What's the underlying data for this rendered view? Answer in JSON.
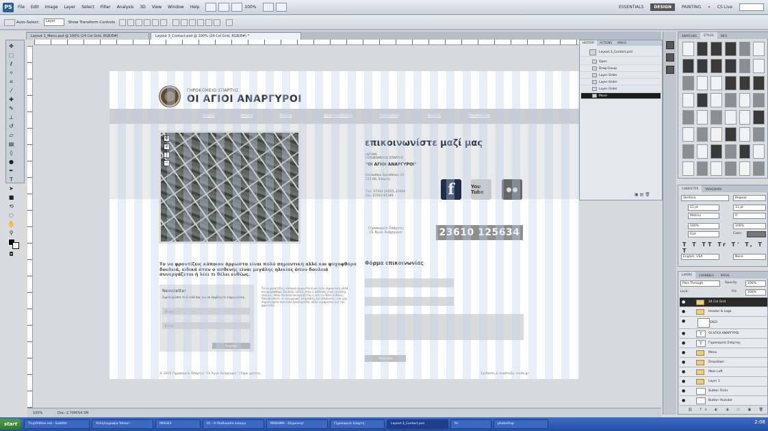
{
  "menubar": {
    "logo": "PS",
    "items": [
      "File",
      "Edit",
      "Image",
      "Layer",
      "Select",
      "Filter",
      "Analysis",
      "3D",
      "View",
      "Window",
      "Help"
    ],
    "zoom": "100%",
    "workspaces": [
      "ESSENTIALS",
      "DESIGN",
      "PAINTING"
    ],
    "more": "»",
    "search": "CS Live"
  },
  "options": {
    "auto_select": "Auto-Select:",
    "auto_select_value": "Layer",
    "show_transform": "Show Transform Controls"
  },
  "doc_tabs": [
    "Layout 1_Menu.psd @ 100% (24 Col Grid, RGB/8#)",
    "Layout 3_Contact.psd @ 100% (24 Col Grid, RGB/8#) *"
  ],
  "site": {
    "subtitle": "ΓΗΡΟΚΟΜΕΙΟ ΣΠΑΡΤΗΣ",
    "title": "ΟΙ ΑΓΙΟΙ ΑΝΑΡΓΥΡΟΙ",
    "nav": [
      "Αρχική",
      "Ιστορία",
      "Ιδρυμα",
      "Δραστηριότητες",
      "Προσωπικό",
      "Δωρεές",
      "Επικοινωνία"
    ],
    "contact_heading": "επικοινωνίστε μαζί μας",
    "org_small": [
      "ΙΔΡΥΜΑ",
      "ΓΕΡΟΚΟΜΕΙΟΝ ΣΠΑΡΤΗΣ"
    ],
    "org_name": "\"ΟΙ ΑΓΙΟΙ ΑΝΑΡΓΥΡΟΙ\"",
    "address": [
      "Επισκόπου Βρεσθένης 20",
      "231 00, Σπάρτη"
    ],
    "phone_fax": [
      "Τηλ. 27310 26555, 23006",
      "Fax. 27310 81340"
    ],
    "social": {
      "facebook": "f",
      "youtube": "You Tube",
      "flickr": "flickr"
    },
    "caption": [
      "Γηροκομείο Σπάρτης",
      "Οι Αγιοι Ανάργυροι"
    ],
    "phone_big": "23610 125634",
    "body_lead": "Το να φροντίζεις κάποιον άρρωστο είναι πολύ σημαντική αλλά και ψυχοφθόρα δουλειά, ειδικά όταν ο ασθενής είναι μεγάλης ηλικίας όπου δουλειά συνεργάζεται ή λέει τι θέλει ευθέως.",
    "newsletter": {
      "title": "Newsletter",
      "text": "Συμπληρώστε το E-mail σας για να λαμβάνετε ενημερώσεις.",
      "name_placeholder": "Όνομα",
      "email_placeholder": "E-mail",
      "submit": "Εγγραφή"
    },
    "info_text": "Το να φροντίζεις κάποιον άρρωστο είναι πολύ σημαντική αλλά και ψυχοφθόρα δουλειά, ειδικά όταν ο ασθενής είναι μεγάλης ηλικίας, όπου δουλειά συνεργάζεται ή λέει τι θέλει ευθέως. Απευθυνθείτε σε κοινωνικές υπηρεσίες και εθελοντές, και μην παραλείψετε ένα καλό ξεκούραστο, άλλο ευχαριστώ για την φροντίδα.",
    "form_title": "Φόρμα επικοινωνίας",
    "form_submit": "Αποστολή",
    "footer_left": "© 2010 Γηροκομείο Σπάρτης \"Οι Άγιοι Ανάργυροι\"  |  Όροι χρήσης",
    "footer_right": "Σχεδίαση & ανάπτυξη: lesite.gr"
  },
  "history": {
    "tabs": [
      "HISTORY",
      "ACTIONS",
      "MINI B"
    ],
    "snapshot": "Layout 3_Contact.psd",
    "items": [
      "Open",
      "Drag Group",
      "Layer Order",
      "Layer Order",
      "Layer Order",
      "Move"
    ]
  },
  "swatches": {
    "tabs": [
      "SWATCHES",
      "STYLES",
      "INFO"
    ]
  },
  "character": {
    "tabs": [
      "CHARACTER",
      "PARAGRAPH"
    ],
    "font": "Verdana",
    "style": "Regular",
    "size": "11 pt",
    "leading": "11 pt",
    "kerning": "Metrics",
    "tracking": "0",
    "vscale": "100%",
    "hscale": "100%",
    "baseline": "0 pt",
    "color_label": "Color:",
    "language": "English: USA",
    "aa": "None"
  },
  "layers": {
    "tabs": [
      "LAYERS",
      "CHANNELS",
      "PATHS"
    ],
    "blend": "Pass Through",
    "opacity_label": "Opacity:",
    "opacity": "100%",
    "fill_label": "Fill:",
    "fill": "100%",
    "lock_label": "Lock:",
    "rows": [
      {
        "name": "24 Col Grid",
        "kind": "folder"
      },
      {
        "name": "Header & Logo",
        "kind": "folder"
      },
      {
        "name": "LOGO",
        "kind": "image"
      },
      {
        "name": "ΟΙ ΑΓΙΟΙ ΑΝΑΡΓΥΡΟΙ",
        "kind": "text"
      },
      {
        "name": "Γηροκομείο Σπάρτης",
        "kind": "text"
      },
      {
        "name": "Menu",
        "kind": "folder"
      },
      {
        "name": "Dropdown",
        "kind": "folder"
      },
      {
        "name": "Main Left",
        "kind": "folder"
      },
      {
        "name": "Layer 1",
        "kind": "folder"
      },
      {
        "name": "Button Flickr",
        "kind": "image"
      },
      {
        "name": "Button Youtube",
        "kind": "image"
      }
    ]
  },
  "status": {
    "zoom": "100%",
    "doc": "Doc: 2.70M/54.3M"
  },
  "taskbar": {
    "start": "start",
    "items": [
      "TinyUtilities.net - Subtitle",
      "Αλληλογραφία Yahoo! -",
      "IMAGES",
      "01 - Η διαδικασία εισαγω",
      "ΜΑΘΗΜΑ - Εξερευνητ",
      "Γηροκομείο Σπαρτη",
      "Layout 3_Contact.psd",
      "Ps",
      "photoshop"
    ],
    "active_index": 6,
    "time": "2:08"
  }
}
